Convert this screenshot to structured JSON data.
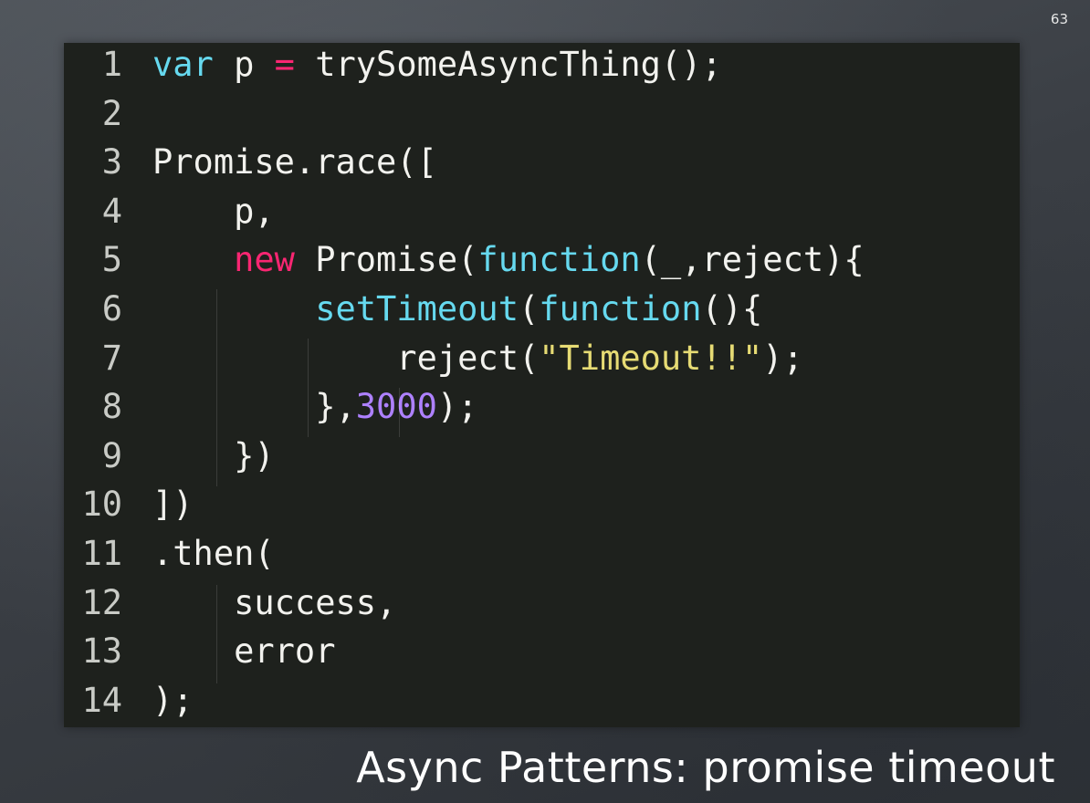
{
  "slide": {
    "number": "63",
    "caption": "Async Patterns: promise timeout"
  },
  "colors": {
    "background": "#3f4449",
    "code_background": "#1e211d",
    "keyword": "#66d9ef",
    "new_keyword": "#f92672",
    "string": "#e6db74",
    "number": "#ae81ff",
    "plain_text": "#f2f2ee"
  },
  "code": {
    "language": "javascript",
    "lines": [
      {
        "number": "1",
        "tokens": [
          {
            "text": "var",
            "type": "keyword"
          },
          {
            "text": " p ",
            "type": "plain"
          },
          {
            "text": "=",
            "type": "operator"
          },
          {
            "text": " trySomeAsyncThing();",
            "type": "plain"
          }
        ]
      },
      {
        "number": "2",
        "tokens": []
      },
      {
        "number": "3",
        "tokens": [
          {
            "text": "Promise.race([",
            "type": "plain"
          }
        ]
      },
      {
        "number": "4",
        "tokens": [
          {
            "text": "    p,",
            "type": "plain"
          }
        ]
      },
      {
        "number": "5",
        "tokens": [
          {
            "text": "    ",
            "type": "plain"
          },
          {
            "text": "new",
            "type": "new"
          },
          {
            "text": " Promise(",
            "type": "plain"
          },
          {
            "text": "function",
            "type": "keyword"
          },
          {
            "text": "(_,reject){",
            "type": "plain"
          }
        ]
      },
      {
        "number": "6",
        "tokens": [
          {
            "text": "        ",
            "type": "plain"
          },
          {
            "text": "setTimeout",
            "type": "keyword"
          },
          {
            "text": "(",
            "type": "plain"
          },
          {
            "text": "function",
            "type": "keyword"
          },
          {
            "text": "(){",
            "type": "plain"
          }
        ]
      },
      {
        "number": "7",
        "tokens": [
          {
            "text": "            reject(",
            "type": "plain"
          },
          {
            "text": "\"Timeout!!\"",
            "type": "string"
          },
          {
            "text": ");",
            "type": "plain"
          }
        ]
      },
      {
        "number": "8",
        "tokens": [
          {
            "text": "        },",
            "type": "plain"
          },
          {
            "text": "3000",
            "type": "number"
          },
          {
            "text": ");",
            "type": "plain"
          }
        ]
      },
      {
        "number": "9",
        "tokens": [
          {
            "text": "    })",
            "type": "plain"
          }
        ]
      },
      {
        "number": "10",
        "tokens": [
          {
            "text": "])",
            "type": "plain"
          }
        ]
      },
      {
        "number": "11",
        "tokens": [
          {
            "text": ".then(",
            "type": "plain"
          }
        ]
      },
      {
        "number": "12",
        "tokens": [
          {
            "text": "    success,",
            "type": "plain"
          }
        ]
      },
      {
        "number": "13",
        "tokens": [
          {
            "text": "    error",
            "type": "plain"
          }
        ]
      },
      {
        "number": "14",
        "tokens": [
          {
            "text": ");",
            "type": "plain"
          }
        ]
      }
    ]
  }
}
